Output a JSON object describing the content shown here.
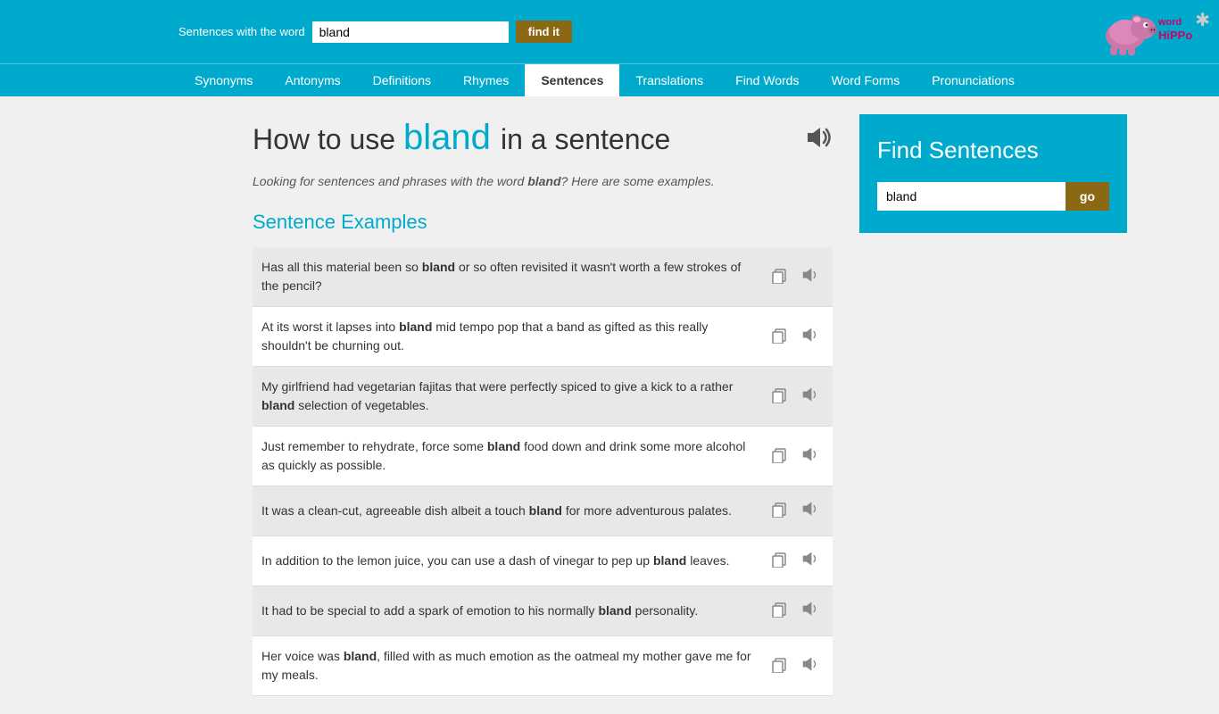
{
  "topbar": {
    "label": "Sentences with the word",
    "search_value": "bland",
    "find_btn": "find it"
  },
  "nav": {
    "items": [
      {
        "label": "Synonyms",
        "active": false
      },
      {
        "label": "Antonyms",
        "active": false
      },
      {
        "label": "Definitions",
        "active": false
      },
      {
        "label": "Rhymes",
        "active": false
      },
      {
        "label": "Sentences",
        "active": true
      },
      {
        "label": "Translations",
        "active": false
      },
      {
        "label": "Find Words",
        "active": false
      },
      {
        "label": "Word Forms",
        "active": false
      },
      {
        "label": "Pronunciations",
        "active": false
      }
    ]
  },
  "page": {
    "title_before": "How to use",
    "title_word": "bland",
    "title_after": "in a sentence",
    "subtitle": "Looking for sentences and phrases with the word",
    "subtitle_word": "bland",
    "subtitle_after": "? Here are some examples.",
    "section_title": "Sentence Examples"
  },
  "sentences": [
    {
      "parts": [
        {
          "text": "Has all this material been so ",
          "bold": false
        },
        {
          "text": "bland",
          "bold": true
        },
        {
          "text": " or so often revisited it wasn't worth a few strokes of the pencil?",
          "bold": false
        }
      ]
    },
    {
      "parts": [
        {
          "text": "At its worst it lapses into ",
          "bold": false
        },
        {
          "text": "bland",
          "bold": true
        },
        {
          "text": " mid tempo pop that a band as gifted as this really shouldn't be churning out.",
          "bold": false
        }
      ]
    },
    {
      "parts": [
        {
          "text": "My girlfriend had vegetarian fajitas that were perfectly spiced to give a kick to a rather ",
          "bold": false
        },
        {
          "text": "bland",
          "bold": true
        },
        {
          "text": " selection of vegetables.",
          "bold": false
        }
      ]
    },
    {
      "parts": [
        {
          "text": "Just remember to rehydrate, force some ",
          "bold": false
        },
        {
          "text": "bland",
          "bold": true
        },
        {
          "text": " food down and drink some more alcohol as quickly as possible.",
          "bold": false
        }
      ]
    },
    {
      "parts": [
        {
          "text": "It was a clean-cut, agreeable dish albeit a touch ",
          "bold": false
        },
        {
          "text": "bland",
          "bold": true
        },
        {
          "text": " for more adventurous palates.",
          "bold": false
        }
      ]
    },
    {
      "parts": [
        {
          "text": "In addition to the lemon juice, you can use a dash of vinegar to pep up ",
          "bold": false
        },
        {
          "text": "bland",
          "bold": true
        },
        {
          "text": " leaves.",
          "bold": false
        }
      ]
    },
    {
      "parts": [
        {
          "text": "It had to be special to add a spark of emotion to his normally ",
          "bold": false
        },
        {
          "text": "bland",
          "bold": true
        },
        {
          "text": " personality.",
          "bold": false
        }
      ]
    },
    {
      "parts": [
        {
          "text": "Her voice was ",
          "bold": false
        },
        {
          "text": "bland",
          "bold": true
        },
        {
          "text": ", filled with as much emotion as the oatmeal my mother gave me for my meals.",
          "bold": false
        }
      ]
    }
  ],
  "sidebar": {
    "title": "Find Sentences",
    "input_value": "bland",
    "go_btn": "go"
  },
  "logo": {
    "text": "word\nhiPPo"
  }
}
